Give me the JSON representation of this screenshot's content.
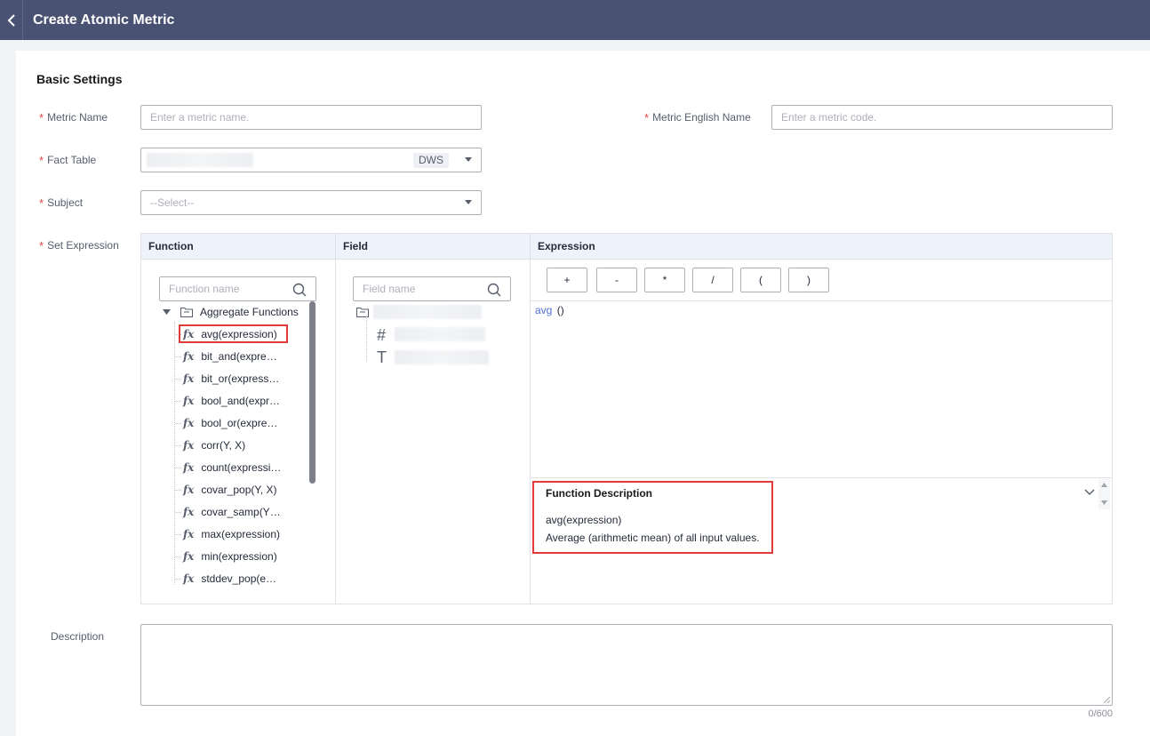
{
  "header": {
    "title": "Create Atomic Metric"
  },
  "section": {
    "title": "Basic Settings"
  },
  "form": {
    "metric_name": {
      "label": "Metric Name",
      "placeholder": "Enter a metric name."
    },
    "metric_english_name": {
      "label": "Metric English Name",
      "placeholder": "Enter a metric code."
    },
    "fact_table": {
      "label": "Fact Table",
      "tag": "DWS"
    },
    "subject": {
      "label": "Subject",
      "value": "--Select--"
    },
    "set_expression": {
      "label": "Set Expression"
    },
    "description": {
      "label": "Description",
      "counter": "0/600"
    },
    "required_mark": "*"
  },
  "expression_panel": {
    "function_header": "Function",
    "field_header": "Field",
    "expression_header": "Expression",
    "function_search_placeholder": "Function name",
    "field_search_placeholder": "Field name",
    "function_group": "Aggregate Functions",
    "fx_glyph": "fx",
    "functions": [
      "avg(expression)",
      "bit_and(expre…",
      "bit_or(express…",
      "bool_and(expr…",
      "bool_or(expre…",
      "corr(Y, X)",
      "count(expressi…",
      "covar_pop(Y, X)",
      "covar_samp(Y…",
      "max(expression)",
      "min(expression)",
      "stddev_pop(e…"
    ],
    "field_type_icons": [
      "#",
      "T"
    ],
    "operators": [
      "+",
      "-",
      "*",
      "/",
      "(",
      ")"
    ],
    "expression_text": {
      "fn": "avg",
      "args": "()"
    },
    "function_description": {
      "title": "Function Description",
      "signature": "avg(expression)",
      "text": "Average (arithmetic mean) of all input values."
    }
  },
  "colors": {
    "header_bg": "#4a5274",
    "highlight": "#e03a3a",
    "expression_fn": "#526ecc"
  }
}
